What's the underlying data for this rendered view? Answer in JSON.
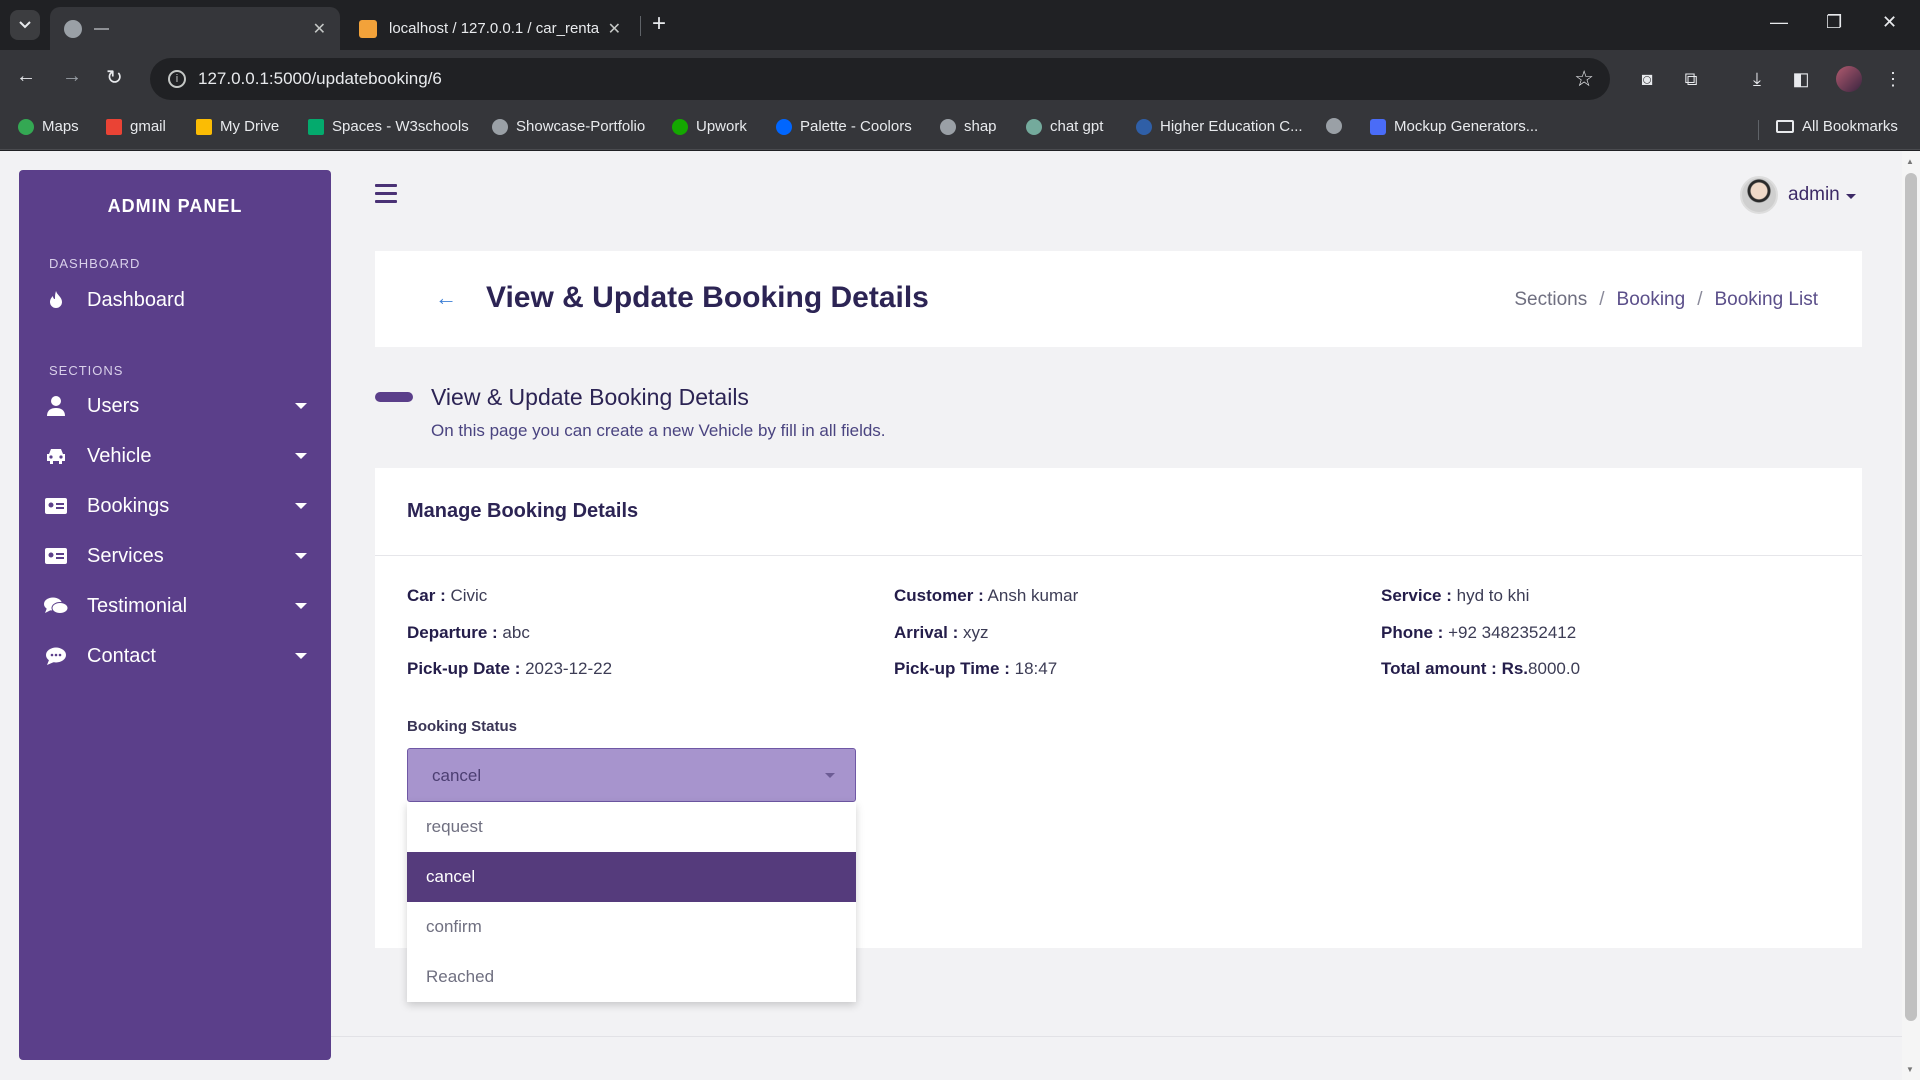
{
  "browser": {
    "tabs": [
      {
        "title": "—",
        "active": true
      },
      {
        "title": "localhost / 127.0.0.1 / car_rental",
        "active": false
      }
    ],
    "url": "127.0.0.1:5000/updatebooking/6",
    "bookmarks": [
      {
        "label": "Maps",
        "color": "#34a853"
      },
      {
        "label": "gmail",
        "color": "#ea4335"
      },
      {
        "label": "My Drive",
        "color": "#fbbc04"
      },
      {
        "label": "Spaces - W3schools",
        "color": "#04aa6d"
      },
      {
        "label": "Showcase-Portfolio",
        "color": "#9aa0a6"
      },
      {
        "label": "Upwork",
        "color": "#14a800"
      },
      {
        "label": "Palette - Coolors",
        "color": "#0066ff"
      },
      {
        "label": "shap",
        "color": "#9aa0a6"
      },
      {
        "label": "chat gpt",
        "color": "#74aa9c"
      },
      {
        "label": "Higher Education C...",
        "color": "#2f5fa7"
      },
      {
        "label": "",
        "color": "#9aa0a6"
      },
      {
        "label": "Mockup Generators...",
        "color": "#4a6cf7"
      }
    ],
    "all_bookmarks": "All Bookmarks"
  },
  "sidebar": {
    "title": "ADMIN PANEL",
    "dashboard_heading": "DASHBOARD",
    "dashboard_item": "Dashboard",
    "sections_heading": "SECTIONS",
    "items": [
      {
        "label": "Users",
        "icon": "user-icon"
      },
      {
        "label": "Vehicle",
        "icon": "car-icon"
      },
      {
        "label": "Bookings",
        "icon": "id-card-icon"
      },
      {
        "label": "Services",
        "icon": "id-card-icon"
      },
      {
        "label": "Testimonial",
        "icon": "comments-icon"
      },
      {
        "label": "Contact",
        "icon": "comment-icon"
      }
    ]
  },
  "header": {
    "username": "admin"
  },
  "title_card": {
    "title": "View & Update Booking Details",
    "breadcrumb": [
      "Sections",
      "Booking",
      "Booking List"
    ]
  },
  "section": {
    "title": "View & Update Booking Details",
    "subtitle": "On this page you can create a new Vehicle by fill in all fields."
  },
  "form": {
    "heading": "Manage Booking Details",
    "fields": {
      "car_label": "Car :",
      "car": "Civic",
      "customer_label": "Customer :",
      "customer": "Ansh kumar",
      "service_label": "Service :",
      "service": "hyd to khi",
      "departure_label": "Departure :",
      "departure": "abc",
      "arrival_label": "Arrival :",
      "arrival": "xyz",
      "phone_label": "Phone :",
      "phone": "+92 3482352412",
      "pickup_date_label": "Pick-up Date :",
      "pickup_date": "2023-12-22",
      "pickup_time_label": "Pick-up Time :",
      "pickup_time": "18:47",
      "total_label": "Total amount :",
      "currency": "Rs.",
      "total": "8000.0"
    },
    "status_label": "Booking Status",
    "status_value": "cancel",
    "status_options": [
      "request",
      "cancel",
      "confirm",
      "Reached"
    ]
  },
  "colors": {
    "sidebar": "#5b3f8a",
    "select_bg": "#a794cd",
    "selected_option": "#553b7c"
  }
}
